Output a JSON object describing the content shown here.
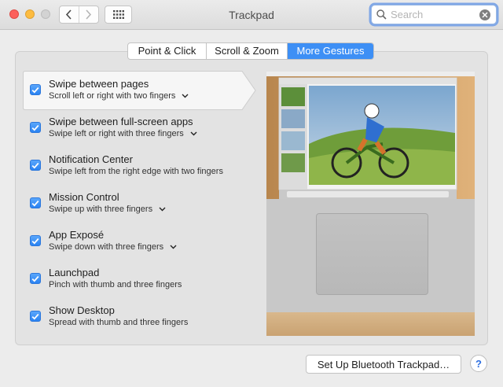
{
  "window": {
    "title": "Trackpad"
  },
  "search": {
    "placeholder": "Search",
    "value": ""
  },
  "tabs": [
    {
      "label": "Point & Click",
      "active": false
    },
    {
      "label": "Scroll & Zoom",
      "active": false
    },
    {
      "label": "More Gestures",
      "active": true
    }
  ],
  "gestures": [
    {
      "title": "Swipe between pages",
      "subtitle": "Scroll left or right with two fingers",
      "checked": true,
      "has_menu": true,
      "selected": true
    },
    {
      "title": "Swipe between full-screen apps",
      "subtitle": "Swipe left or right with three fingers",
      "checked": true,
      "has_menu": true,
      "selected": false
    },
    {
      "title": "Notification Center",
      "subtitle": "Swipe left from the right edge with two fingers",
      "checked": true,
      "has_menu": false,
      "selected": false
    },
    {
      "title": "Mission Control",
      "subtitle": "Swipe up with three fingers",
      "checked": true,
      "has_menu": true,
      "selected": false
    },
    {
      "title": "App Exposé",
      "subtitle": "Swipe down with three fingers",
      "checked": true,
      "has_menu": true,
      "selected": false
    },
    {
      "title": "Launchpad",
      "subtitle": "Pinch with thumb and three fingers",
      "checked": true,
      "has_menu": false,
      "selected": false
    },
    {
      "title": "Show Desktop",
      "subtitle": "Spread with thumb and three fingers",
      "checked": true,
      "has_menu": false,
      "selected": false
    }
  ],
  "footer": {
    "bluetooth_button": "Set Up Bluetooth Trackpad…",
    "help": "?"
  },
  "colors": {
    "accent": "#3d8ff5",
    "close": "#fc605c",
    "minimize": "#fdbc40"
  }
}
